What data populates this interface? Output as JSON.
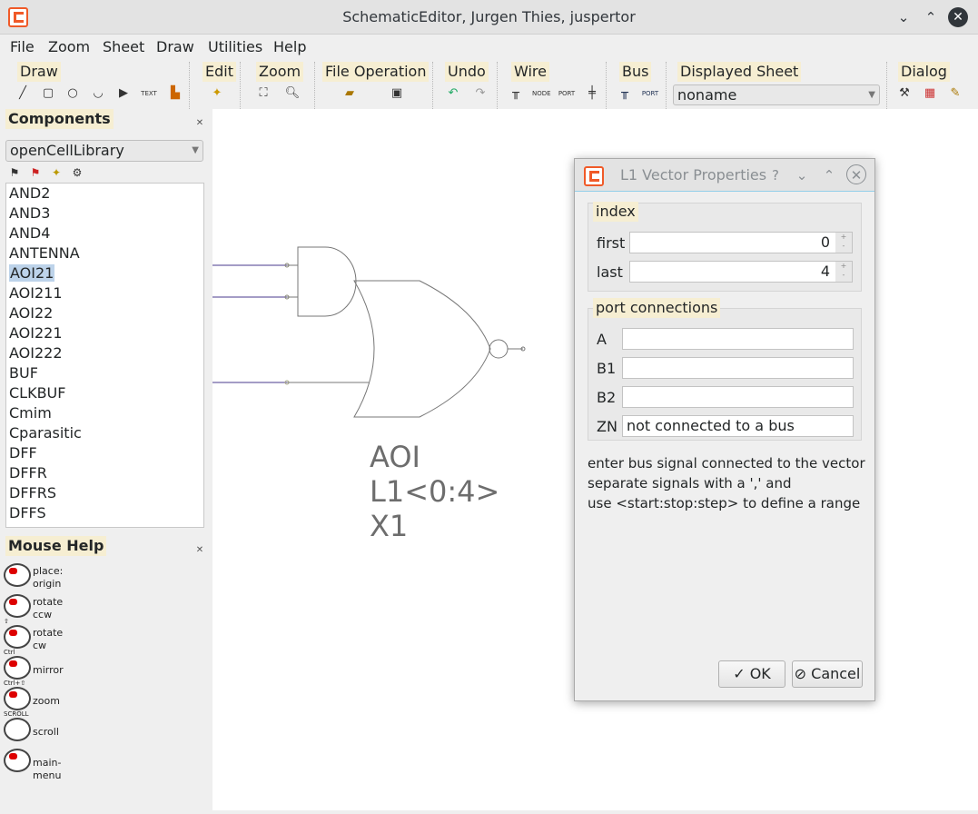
{
  "window": {
    "title": "SchematicEditor, Jurgen Thies, juspertor",
    "minimize": "⌄",
    "maximize": "⌃",
    "close": "✕"
  },
  "menu": [
    "File",
    "Zoom",
    "Sheet",
    "Draw",
    "Utilities",
    "Help"
  ],
  "toolbar": {
    "groups": [
      "Draw",
      "Edit",
      "Zoom",
      "File Operation",
      "Undo",
      "Wire",
      "Bus",
      "Displayed Sheet",
      "Dialog"
    ],
    "draw_text_tool": "TEXT",
    "wire_tools": [
      "NODE",
      "PORT"
    ],
    "bus_tools": [
      "PORT"
    ],
    "displayed_sheet": "noname"
  },
  "components_panel": {
    "title": "Components",
    "library": "openCellLibrary",
    "items": [
      "AND2",
      "AND3",
      "AND4",
      "ANTENNA",
      "AOI21",
      "AOI211",
      "AOI22",
      "AOI221",
      "AOI222",
      "BUF",
      "CLKBUF",
      "Cmim",
      "Cparasitic",
      "DFF",
      "DFFR",
      "DFFRS",
      "DFFS"
    ],
    "selected": "AOI21"
  },
  "mouse_help": {
    "title": "Mouse Help",
    "rows": [
      {
        "line1": "place:",
        "line2": "origin",
        "modifier": ""
      },
      {
        "line1": "rotate",
        "line2": "ccw",
        "modifier": "⇧"
      },
      {
        "line1": "rotate",
        "line2": "cw",
        "modifier": "Ctrl"
      },
      {
        "line1": "mirror",
        "line2": "",
        "modifier": "Ctrl+⇧"
      },
      {
        "line1": "zoom",
        "line2": "",
        "modifier": "SCROLL"
      },
      {
        "line1": "scroll",
        "line2": "",
        "modifier": ""
      },
      {
        "line1": "main-menu",
        "line2": "",
        "modifier": ""
      }
    ]
  },
  "schematic": {
    "label_line1": "AOI",
    "label_line2": "L1<0:4>",
    "label_line3": "X1"
  },
  "dialog": {
    "title": "L1 Vector Properties",
    "help": "?",
    "index_title": "index",
    "first_label": "first",
    "first_value": "0",
    "last_label": "last",
    "last_value": "4",
    "ports_title": "port connections",
    "ports": [
      {
        "name": "A",
        "value": ""
      },
      {
        "name": "B1",
        "value": ""
      },
      {
        "name": "B2",
        "value": ""
      },
      {
        "name": "ZN",
        "value": "not connected to a bus"
      }
    ],
    "hint_line1": "enter bus signal connected to the vector",
    "hint_line2": "separate signals with a ',' and",
    "hint_line3": "use <start:stop:step> to define a range",
    "ok_label": "OK",
    "cancel_label": "Cancel"
  }
}
